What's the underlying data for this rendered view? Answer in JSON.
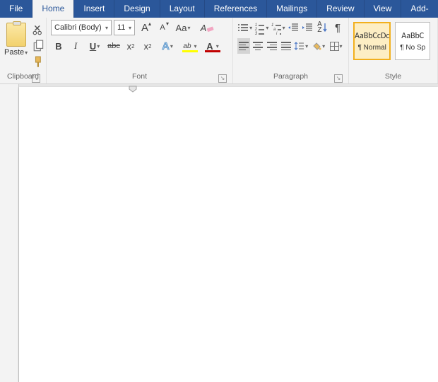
{
  "tabs": [
    "File",
    "Home",
    "Insert",
    "Design",
    "Layout",
    "References",
    "Mailings",
    "Review",
    "View",
    "Add-in"
  ],
  "activeTab": 1,
  "ribbon": {
    "clipboard": {
      "label": "Clipboard",
      "paste": "Paste"
    },
    "font": {
      "label": "Font",
      "name": "Calibri (Body)",
      "size": "11",
      "growA": "A",
      "shrinkA": "A",
      "caseAa": "Aa",
      "clearFmt": "A",
      "bold": "B",
      "italic": "I",
      "underline": "U",
      "strike": "abc",
      "sub": "x",
      "sup": "x",
      "textEffect": "A",
      "highlight": "ab",
      "fontColor": "A",
      "highlightColor": "#ffff00",
      "fontColorVal": "#c00000",
      "effectColor": "#2e75b6"
    },
    "paragraph": {
      "label": "Paragraph"
    },
    "styles": {
      "label": "Style",
      "items": [
        {
          "preview": "AaBbCcDc",
          "name": "¶ Normal"
        },
        {
          "preview": "AaBbC",
          "name": "¶ No Sp"
        }
      ]
    }
  }
}
